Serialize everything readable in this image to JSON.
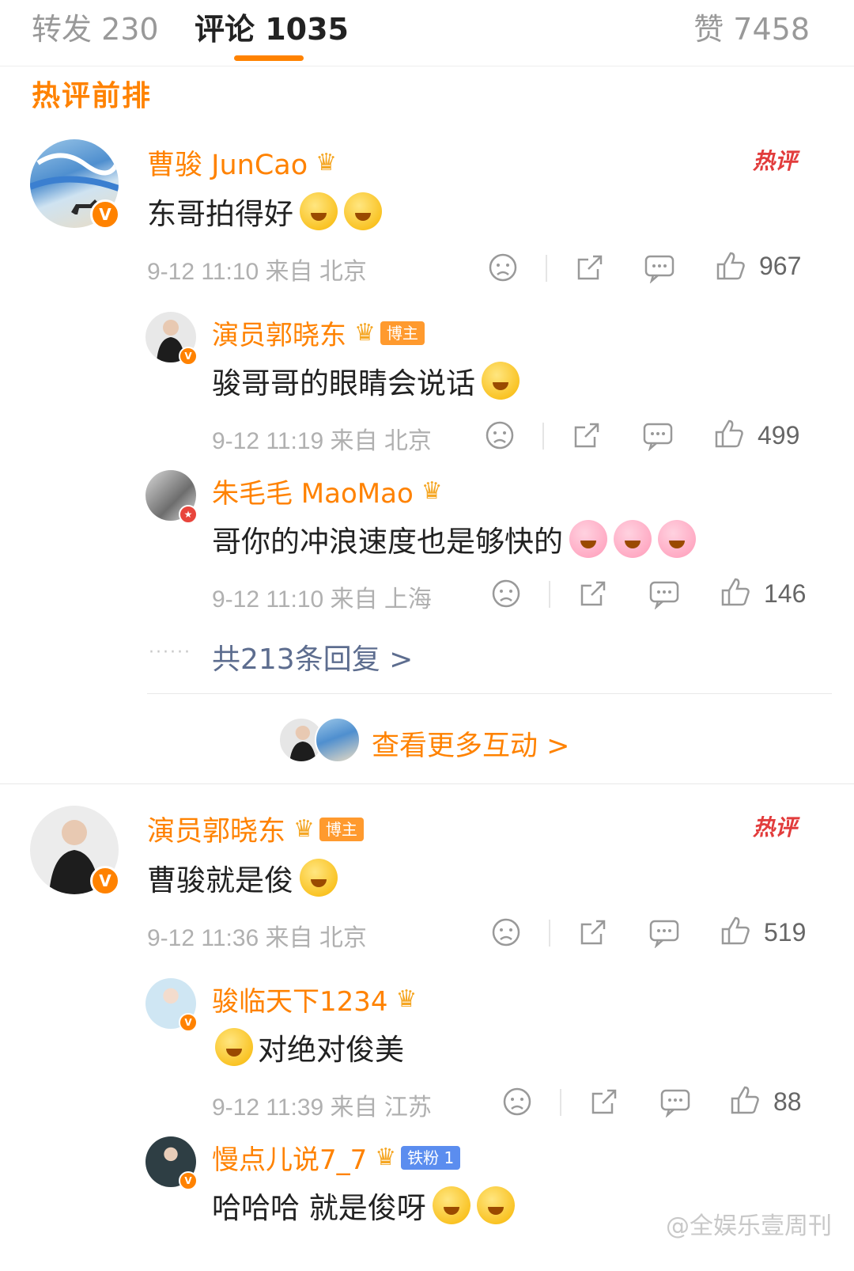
{
  "tabs": {
    "repost": "转发 230",
    "comment": "评论 1035",
    "like": "赞 7458"
  },
  "section_title": "热评前排",
  "hot_label": "热评",
  "comments": [
    {
      "name": "曹骏 JunCao",
      "text": "东哥拍得好",
      "meta": "9-12 11:10  来自 北京",
      "likes": "967",
      "replies": [
        {
          "name": "演员郭晓东",
          "tag": "博主",
          "text": "骏哥哥的眼睛会说话",
          "meta": "9-12 11:19  来自 北京",
          "likes": "499"
        },
        {
          "name": "朱毛毛 MaoMao",
          "text": "哥你的冲浪速度也是够快的",
          "meta": "9-12 11:10  来自 上海",
          "likes": "146"
        }
      ],
      "more_replies": "共213条回复 >",
      "more_interact": "查看更多互动 >"
    },
    {
      "name": "演员郭晓东",
      "tag": "博主",
      "text": "曹骏就是俊",
      "meta": "9-12 11:36  来自 北京",
      "likes": "519",
      "replies": [
        {
          "name": "骏临天下1234",
          "text": "对绝对俊美",
          "meta": "9-12 11:39  来自 江苏",
          "likes": "88"
        },
        {
          "name": "慢点儿说7_7",
          "tag": "铁粉 1",
          "text": "哈哈哈 就是俊呀"
        }
      ]
    }
  ],
  "watermark": "@全娱乐壹周刊",
  "colors": {
    "accent": "#ff8200",
    "hot": "#e23c3c",
    "link": "#5d6d8f"
  }
}
